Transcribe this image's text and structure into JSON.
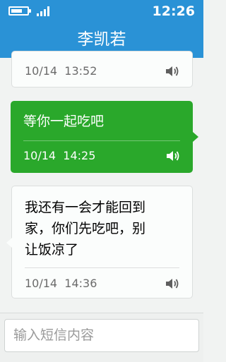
{
  "status_bar": {
    "time": "12:26",
    "battery_level": 0.7,
    "signal_bars": 4,
    "icons": [
      "battery-icon",
      "signal-icon"
    ]
  },
  "header": {
    "title": "李凯若"
  },
  "messages": [
    {
      "direction": "incoming",
      "text": "",
      "date": "10/14",
      "time": "13:52",
      "icon": "speaker-icon"
    },
    {
      "direction": "outgoing",
      "text": "等你一起吃吧",
      "date": "10/14",
      "time": "14:25",
      "icon": "speaker-icon"
    },
    {
      "direction": "incoming",
      "text_lines": [
        "我还有一会才能回到",
        "家，你们先吃吧，别",
        "让饭凉了"
      ],
      "date": "10/14",
      "time": "14:36",
      "icon": "speaker-icon"
    }
  ],
  "composer": {
    "placeholder": "输入短信内容"
  },
  "colors": {
    "header": "#2a92d6",
    "outgoing_bubble": "#2aa82b",
    "incoming_bubble": "#fbfdfc",
    "background": "#f1f3f2"
  }
}
